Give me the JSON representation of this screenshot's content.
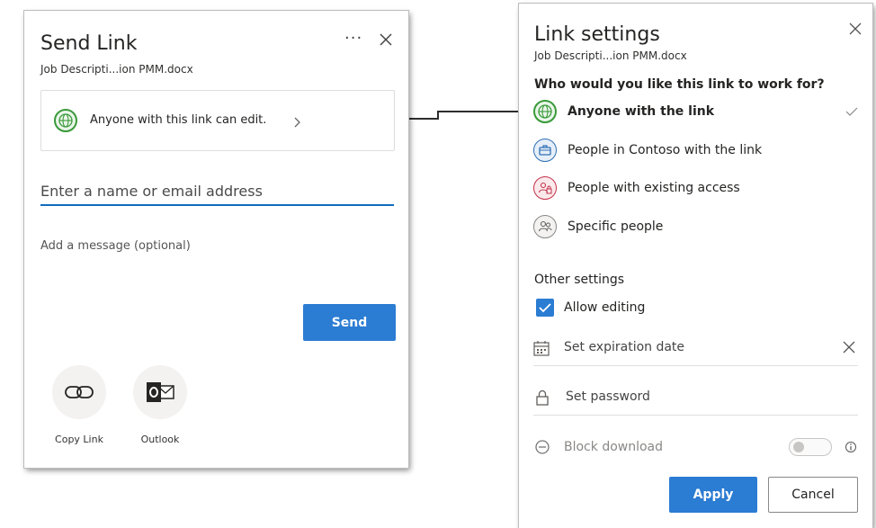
{
  "send_link": {
    "title": "Send Link",
    "file_name": "Job Descripti...ion PMM.docx",
    "more_label": "···",
    "permission_text": "Anyone with this link can edit.",
    "email_placeholder": "Enter a name or email address",
    "message_placeholder": "Add a message (optional)",
    "send_label": "Send",
    "share_options": [
      {
        "label": "Copy Link",
        "icon": "link-icon"
      },
      {
        "label": "Outlook",
        "icon": "outlook-icon"
      }
    ]
  },
  "link_settings": {
    "title": "Link settings",
    "file_name": "Job Descripti...ion PMM.docx",
    "question": "Who would you like this link to work for?",
    "options": [
      {
        "label": "Anyone with the link",
        "icon": "globe-icon",
        "selected": true
      },
      {
        "label": "People in Contoso with the link",
        "icon": "briefcase-icon",
        "selected": false
      },
      {
        "label": "People with existing access",
        "icon": "people-lock-icon",
        "selected": false
      },
      {
        "label": "Specific people",
        "icon": "people-icon",
        "selected": false
      }
    ],
    "other_settings_heading": "Other settings",
    "allow_editing_label": "Allow editing",
    "allow_editing_checked": true,
    "expiration_placeholder": "Set expiration date",
    "password_placeholder": "Set password",
    "block_download_label": "Block download",
    "block_download_on": false,
    "apply_label": "Apply",
    "cancel_label": "Cancel"
  },
  "colors": {
    "accent": "#2b7cd3",
    "globe": "#3a9a3a",
    "org": "#2f6fb3",
    "existing": "#c4314b",
    "specific": "#605e5c"
  }
}
